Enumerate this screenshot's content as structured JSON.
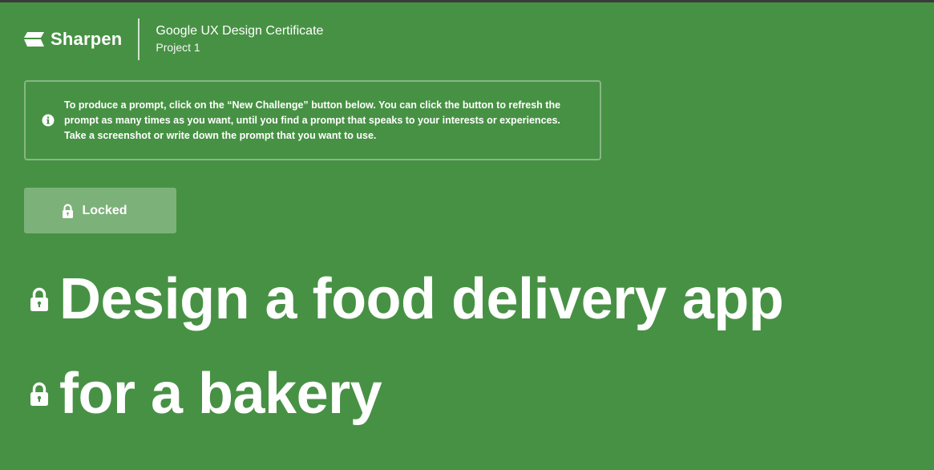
{
  "header": {
    "brand_name": "Sharpen",
    "course_title": "Google UX Design Certificate",
    "course_subtitle": "Project 1"
  },
  "info": {
    "icon": "info-icon",
    "text": "To produce a prompt, click on the “New Challenge” button below. You can click the button to refresh the prompt as many times as you want, until you find a prompt that speaks to your interests or experiences. Take a screenshot or write down the prompt that you want to use."
  },
  "button": {
    "icon": "lock-icon",
    "label": "Locked"
  },
  "prompt": {
    "line1": "Design a food delivery app",
    "line2": "for a bakery"
  },
  "colors": {
    "background": "#479144",
    "button_background": "#7cb279",
    "text": "#ffffff"
  }
}
